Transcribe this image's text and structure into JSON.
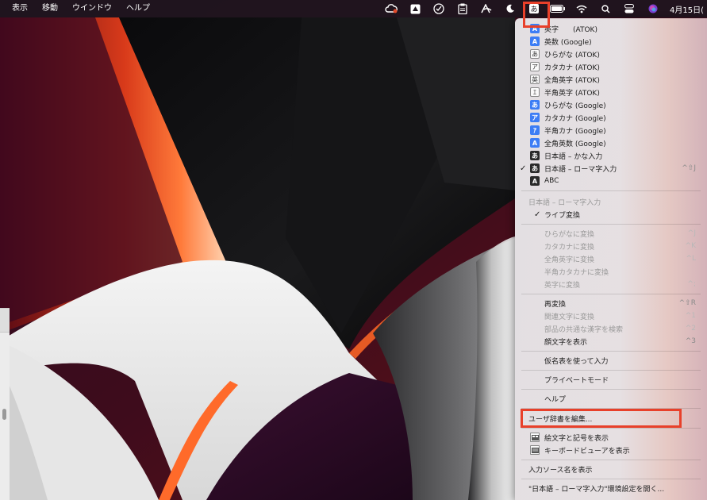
{
  "menubar": {
    "items": [
      "表示",
      "移動",
      "ウインドウ",
      "ヘルプ"
    ],
    "status_icons": [
      "creative-cloud-icon",
      "google-drive-icon",
      "checklist-icon",
      "clipboard-icon",
      "arc-icon",
      "moon-icon",
      "ime-icon",
      "battery-icon",
      "wifi-icon",
      "search-icon",
      "control-center-icon",
      "siri-icon"
    ],
    "clock": "4月15日("
  },
  "dropdown": {
    "sources": [
      {
        "badge": "A",
        "badge_style": "blue",
        "label": "英字　　(ATOK)",
        "checked": false
      },
      {
        "badge": "A",
        "badge_style": "blue",
        "label": "英数 (Google)",
        "checked": false
      },
      {
        "badge": "あ",
        "badge_style": "outline",
        "label": "ひらがな (ATOK)",
        "checked": false
      },
      {
        "badge": "ア",
        "badge_style": "outline",
        "label": "カタカナ (ATOK)",
        "checked": false
      },
      {
        "badge": "英",
        "badge_style": "outline",
        "label": "全角英字 (ATOK)",
        "checked": false
      },
      {
        "badge": "ｴ",
        "badge_style": "outline",
        "label": "半角英字 (ATOK)",
        "checked": false
      },
      {
        "badge": "あ",
        "badge_style": "blue",
        "label": "ひらがな (Google)",
        "checked": false
      },
      {
        "badge": "ア",
        "badge_style": "blue",
        "label": "カタカナ (Google)",
        "checked": false
      },
      {
        "badge": "ｱ",
        "badge_style": "blue",
        "label": "半角カナ (Google)",
        "checked": false
      },
      {
        "badge": "A",
        "badge_style": "blue",
        "label": "全角英数 (Google)",
        "checked": false
      },
      {
        "badge": "あ",
        "badge_style": "dark",
        "label": "日本語 – かな入力",
        "checked": false
      },
      {
        "badge": "あ",
        "badge_style": "dark",
        "label": "日本語 – ローマ字入力",
        "checked": true,
        "shortcut": "^⇧J"
      },
      {
        "badge": "A",
        "badge_style": "dark",
        "label": "ABC",
        "checked": false
      }
    ],
    "section_header": "日本語 – ローマ字入力",
    "live_conversion": {
      "label": "ライブ変換",
      "checked": true
    },
    "conversions": [
      {
        "label": "ひらがなに変換",
        "shortcut": "^J",
        "disabled": true
      },
      {
        "label": "カタカナに変換",
        "shortcut": "^K",
        "disabled": true
      },
      {
        "label": "全角英字に変換",
        "shortcut": "^L",
        "disabled": true
      },
      {
        "label": "半角カタカナに変換",
        "shortcut": "",
        "disabled": true
      },
      {
        "label": "英字に変換",
        "shortcut": "^;",
        "disabled": true
      }
    ],
    "reconvert": [
      {
        "label": "再変換",
        "shortcut": "^⇧R",
        "disabled": false
      },
      {
        "label": "関連文字に変換",
        "shortcut": "^1",
        "disabled": true
      },
      {
        "label": "部品の共通な漢字を検索",
        "shortcut": "^2",
        "disabled": true
      },
      {
        "label": "顔文字を表示",
        "shortcut": "^3",
        "disabled": false
      }
    ],
    "kana_table": "仮名表を使って入力",
    "private_mode": "プライベートモード",
    "help": "ヘルプ",
    "edit_user_dict": "ユーザ辞書を編集...",
    "emoji_viewer": "絵文字と記号を表示",
    "keyboard_viewer": "キーボードビューアを表示",
    "show_source_name": "入力ソース名を表示",
    "open_prefs": "\"日本語 – ローマ字入力\"環境設定を開く..."
  },
  "colors": {
    "highlight": "#e8402a",
    "badge_blue": "#3c7df5",
    "menubar_bg": "#1e161e"
  }
}
